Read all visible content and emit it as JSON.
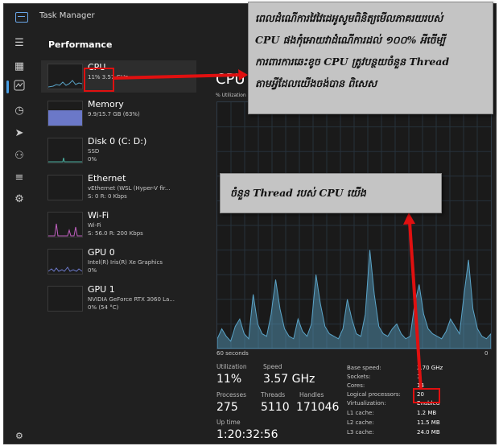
{
  "window": {
    "title": "Task Manager"
  },
  "page": {
    "title": "Performance"
  },
  "rail": {
    "icons": [
      "menu-icon",
      "processes-icon",
      "performance-icon",
      "history-icon",
      "startup-icon",
      "users-icon",
      "details-icon",
      "services-icon",
      "settings-icon"
    ]
  },
  "devices": [
    {
      "name": "CPU",
      "line1": "11%  3.57 GHz",
      "line2": ""
    },
    {
      "name": "Memory",
      "line1": "9.9/15.7 GB (63%)",
      "line2": ""
    },
    {
      "name": "Disk 0 (C: D:)",
      "line1": "SSD",
      "line2": "0%"
    },
    {
      "name": "Ethernet",
      "line1": "vEthernet (WSL (Hyper-V fir...",
      "line2": "S: 0  R: 0 Kbps"
    },
    {
      "name": "Wi-Fi",
      "line1": "Wi-Fi",
      "line2": "S: 56.0  R: 200 Kbps"
    },
    {
      "name": "GPU 0",
      "line1": "Intel(R) Iris(R) Xe Graphics",
      "line2": "0%"
    },
    {
      "name": "GPU 1",
      "line1": "NVIDIA GeForce RTX 3060 La...",
      "line2": "0% (54 °C)"
    }
  ],
  "main": {
    "title": "CPU",
    "utilization_axis": "% Utilization",
    "axis_left": "60 seconds",
    "axis_right": "0",
    "stats": {
      "utilization_label": "Utilization",
      "utilization": "11%",
      "speed_label": "Speed",
      "speed": "3.57 GHz",
      "processes_label": "Processes",
      "processes": "275",
      "threads_label": "Threads",
      "threads": "5110",
      "handles_label": "Handles",
      "handles": "171046",
      "uptime_label": "Up time",
      "uptime": "1:20:32:56"
    },
    "specs": [
      {
        "k": "Base speed:",
        "v": "2.70 GHz"
      },
      {
        "k": "Sockets:",
        "v": "1"
      },
      {
        "k": "Cores:",
        "v": "14"
      },
      {
        "k": "Logical processors:",
        "v": "20"
      },
      {
        "k": "Virtualization:",
        "v": "Enabled"
      },
      {
        "k": "L1 cache:",
        "v": "1.2 MB"
      },
      {
        "k": "L2 cache:",
        "v": "11.5 MB"
      },
      {
        "k": "L3 cache:",
        "v": "24.0 MB"
      }
    ],
    "cpu_history": [
      4,
      8,
      5,
      3,
      9,
      12,
      6,
      4,
      22,
      10,
      6,
      5,
      14,
      28,
      16,
      8,
      5,
      4,
      12,
      7,
      5,
      10,
      30,
      18,
      9,
      6,
      5,
      4,
      8,
      20,
      12,
      6,
      5,
      14,
      40,
      22,
      9,
      6,
      5,
      8,
      10,
      6,
      4,
      5,
      18,
      26,
      14,
      8,
      6,
      5,
      4,
      7,
      12,
      9,
      6,
      22,
      36,
      16,
      8,
      5,
      4,
      6
    ]
  },
  "annotations": {
    "top": [
      "ពេលដំណើការវៃវៃដេអូសូមពិនិត្យមើលភាគរយរបស់",
      "CPU  ផងកុំអោយវាដំណើការដល់ ១០០% អីចើម្បី",
      "ការពារការឆេះខូច CPU ត្រូវបន្ថយចំនួន  Thread",
      "តាមអ្វីដែលយើងចង់បាន ពិសេស"
    ],
    "mid": "ចំនួន Thread របស់ CPU យើង"
  },
  "colors": {
    "accent": "#4aa0e6",
    "cpu_graph": "#5aa4c8",
    "memory_fill": "#6b78c8",
    "disk": "#4ab0a0",
    "wifi": "#c060c0",
    "annotation_red": "#e01010"
  }
}
